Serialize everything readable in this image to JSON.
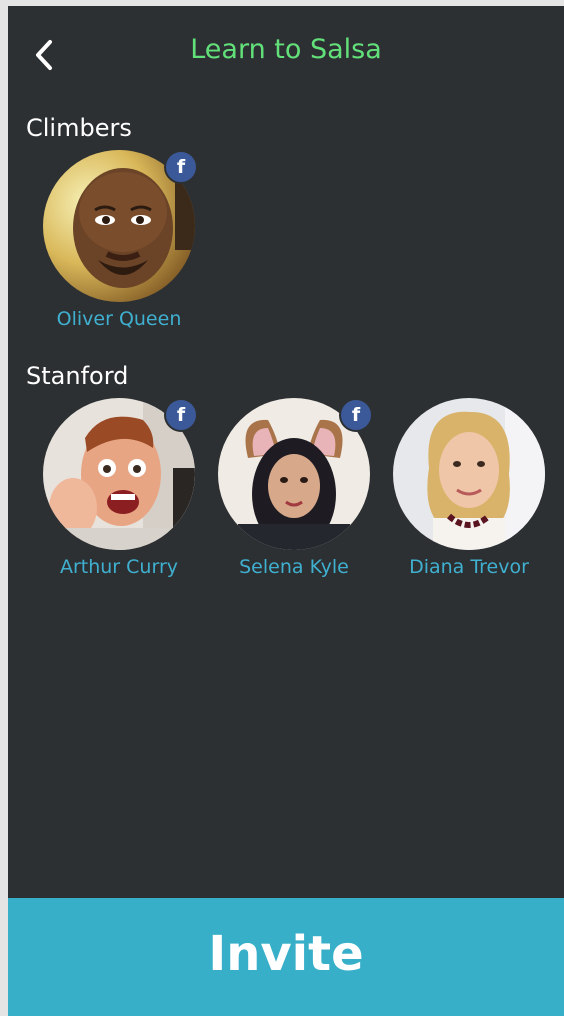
{
  "header": {
    "title": "Learn to Salsa",
    "back_icon": "chevron-left-icon"
  },
  "sections": [
    {
      "title": "Climbers",
      "friends": [
        {
          "name": "Oliver Queen",
          "facebook": true
        }
      ]
    },
    {
      "title": "Stanford",
      "friends": [
        {
          "name": "Arthur Curry",
          "facebook": true
        },
        {
          "name": "Selena Kyle",
          "facebook": true
        },
        {
          "name": "Diana Trevor",
          "facebook": false
        }
      ]
    }
  ],
  "facebook_badge": "f",
  "invite_label": "Invite",
  "colors": {
    "background": "#2d3033",
    "title": "#62e07a",
    "name": "#3fb0cf",
    "invite": "#38afc9",
    "facebook": "#3b5998"
  }
}
